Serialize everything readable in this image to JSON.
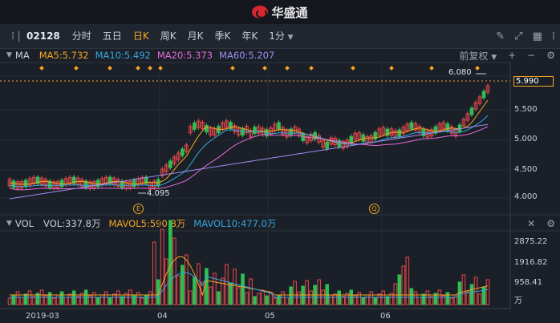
{
  "app": {
    "title": "华盛通"
  },
  "toolbar": {
    "code": "02128",
    "tabs": [
      "分时",
      "五日",
      "日K",
      "周K",
      "月K",
      "季K",
      "年K"
    ],
    "active_tab": "日K",
    "interval": "1分"
  },
  "main_panel": {
    "indicator": "MA",
    "ma": [
      {
        "label": "MA5:5.732",
        "color": "#f5a623"
      },
      {
        "label": "MA10:5.492",
        "color": "#35a7e0"
      },
      {
        "label": "MA20:5.373",
        "color": "#e26ad6"
      },
      {
        "label": "MA60:5.207",
        "color": "#9f8cf0"
      }
    ],
    "adjust": "前复权",
    "high_label": "6.080",
    "low_label": "4.095",
    "current_price": "5.990",
    "axis": [
      "5.500",
      "5.000",
      "4.500",
      "4.000"
    ],
    "markers": [
      "E",
      "Q"
    ]
  },
  "vol_panel": {
    "indicator": "VOL",
    "items": [
      {
        "label": "VOL:337.8万",
        "color": "#c9ced6"
      },
      {
        "label": "MAVOL5:590.8万",
        "color": "#f5a623"
      },
      {
        "label": "MAVOL10:477.0万",
        "color": "#35a7e0"
      }
    ],
    "axis": [
      "2875.22",
      "1916.82",
      "958.41"
    ],
    "unit": "万"
  },
  "dates": [
    "2019-03",
    "04",
    "05",
    "06"
  ],
  "colors": {
    "up": "#e8474b",
    "down": "#2fbf52",
    "accent": "#f5a623"
  }
}
